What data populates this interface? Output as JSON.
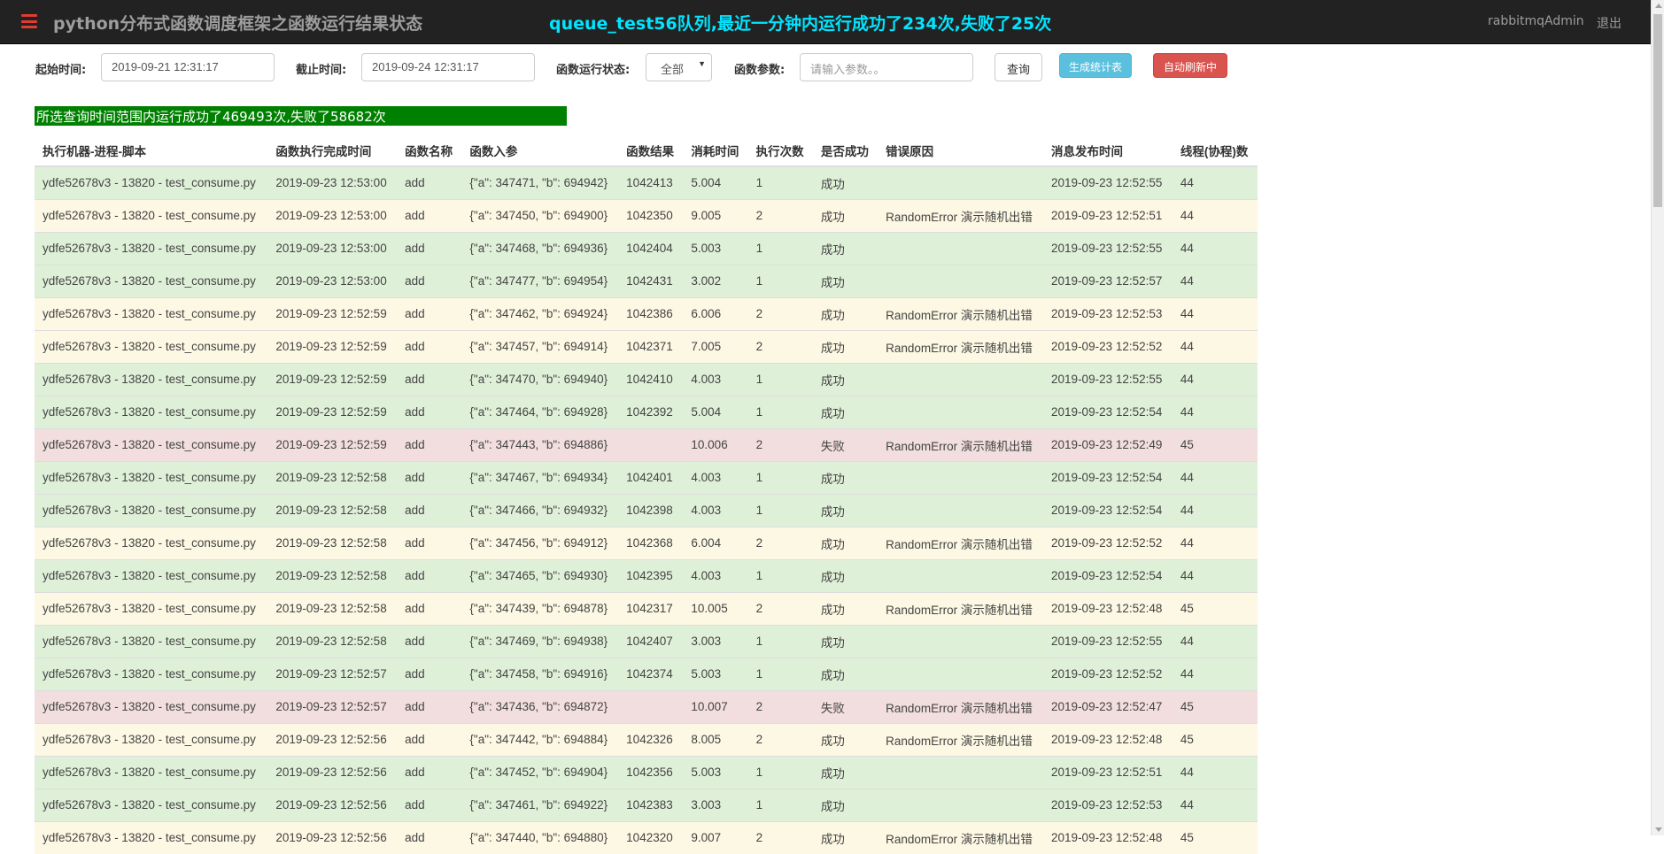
{
  "nav": {
    "title": "python分布式函数调度框架之函数运行结果状态",
    "summary": "queue_test56队列,最近一分钟内运行成功了234次,失败了25次",
    "user": "rabbitmqAdmin",
    "logout": "退出"
  },
  "filters": {
    "start_label": "起始时间:",
    "start_value": "2019-09-21 12:31:17",
    "end_label": "截止时间:",
    "end_value": "2019-09-24 12:31:17",
    "status_label": "函数运行状态:",
    "status_value": "全部",
    "params_label": "函数参数:",
    "params_placeholder": "请输入参数。。",
    "query_button": "查询",
    "stats_button": "生成统计表",
    "refresh_button": "自动刷新中"
  },
  "result_summary": "所选查询时间范围内运行成功了469493次,失败了58682次",
  "colors": {
    "success_row": "#dff0d8",
    "warning_row": "#fcf8e3",
    "danger_row": "#f2dede",
    "accent": "#00e5ff",
    "summary_bar": "#008000"
  },
  "table": {
    "headers": [
      "执行机器-进程-脚本",
      "函数执行完成时间",
      "函数名称",
      "函数入参",
      "函数结果",
      "消耗时间",
      "执行次数",
      "是否成功",
      "错误原因",
      "消息发布时间",
      "线程(协程)数"
    ],
    "rows": [
      {
        "status": "success",
        "cells": [
          "ydfe52678v3 - 13820 - test_consume.py",
          "2019-09-23 12:53:00",
          "add",
          "{\"a\": 347471, \"b\": 694942}",
          "1042413",
          "5.004",
          "1",
          "成功",
          "",
          "2019-09-23 12:52:55",
          "44"
        ]
      },
      {
        "status": "warning",
        "cells": [
          "ydfe52678v3 - 13820 - test_consume.py",
          "2019-09-23 12:53:00",
          "add",
          "{\"a\": 347450, \"b\": 694900}",
          "1042350",
          "9.005",
          "2",
          "成功",
          "RandomError 演示随机出错",
          "2019-09-23 12:52:51",
          "44"
        ]
      },
      {
        "status": "success",
        "cells": [
          "ydfe52678v3 - 13820 - test_consume.py",
          "2019-09-23 12:53:00",
          "add",
          "{\"a\": 347468, \"b\": 694936}",
          "1042404",
          "5.003",
          "1",
          "成功",
          "",
          "2019-09-23 12:52:55",
          "44"
        ]
      },
      {
        "status": "success",
        "cells": [
          "ydfe52678v3 - 13820 - test_consume.py",
          "2019-09-23 12:53:00",
          "add",
          "{\"a\": 347477, \"b\": 694954}",
          "1042431",
          "3.002",
          "1",
          "成功",
          "",
          "2019-09-23 12:52:57",
          "44"
        ]
      },
      {
        "status": "warning",
        "cells": [
          "ydfe52678v3 - 13820 - test_consume.py",
          "2019-09-23 12:52:59",
          "add",
          "{\"a\": 347462, \"b\": 694924}",
          "1042386",
          "6.006",
          "2",
          "成功",
          "RandomError 演示随机出错",
          "2019-09-23 12:52:53",
          "44"
        ]
      },
      {
        "status": "warning",
        "cells": [
          "ydfe52678v3 - 13820 - test_consume.py",
          "2019-09-23 12:52:59",
          "add",
          "{\"a\": 347457, \"b\": 694914}",
          "1042371",
          "7.005",
          "2",
          "成功",
          "RandomError 演示随机出错",
          "2019-09-23 12:52:52",
          "44"
        ]
      },
      {
        "status": "success",
        "cells": [
          "ydfe52678v3 - 13820 - test_consume.py",
          "2019-09-23 12:52:59",
          "add",
          "{\"a\": 347470, \"b\": 694940}",
          "1042410",
          "4.003",
          "1",
          "成功",
          "",
          "2019-09-23 12:52:55",
          "44"
        ]
      },
      {
        "status": "success",
        "cells": [
          "ydfe52678v3 - 13820 - test_consume.py",
          "2019-09-23 12:52:59",
          "add",
          "{\"a\": 347464, \"b\": 694928}",
          "1042392",
          "5.004",
          "1",
          "成功",
          "",
          "2019-09-23 12:52:54",
          "44"
        ]
      },
      {
        "status": "danger",
        "cells": [
          "ydfe52678v3 - 13820 - test_consume.py",
          "2019-09-23 12:52:59",
          "add",
          "{\"a\": 347443, \"b\": 694886}",
          "",
          "10.006",
          "2",
          "失败",
          "RandomError 演示随机出错",
          "2019-09-23 12:52:49",
          "45"
        ]
      },
      {
        "status": "success",
        "cells": [
          "ydfe52678v3 - 13820 - test_consume.py",
          "2019-09-23 12:52:58",
          "add",
          "{\"a\": 347467, \"b\": 694934}",
          "1042401",
          "4.003",
          "1",
          "成功",
          "",
          "2019-09-23 12:52:54",
          "44"
        ]
      },
      {
        "status": "success",
        "cells": [
          "ydfe52678v3 - 13820 - test_consume.py",
          "2019-09-23 12:52:58",
          "add",
          "{\"a\": 347466, \"b\": 694932}",
          "1042398",
          "4.003",
          "1",
          "成功",
          "",
          "2019-09-23 12:52:54",
          "44"
        ]
      },
      {
        "status": "warning",
        "cells": [
          "ydfe52678v3 - 13820 - test_consume.py",
          "2019-09-23 12:52:58",
          "add",
          "{\"a\": 347456, \"b\": 694912}",
          "1042368",
          "6.004",
          "2",
          "成功",
          "RandomError 演示随机出错",
          "2019-09-23 12:52:52",
          "44"
        ]
      },
      {
        "status": "success",
        "cells": [
          "ydfe52678v3 - 13820 - test_consume.py",
          "2019-09-23 12:52:58",
          "add",
          "{\"a\": 347465, \"b\": 694930}",
          "1042395",
          "4.003",
          "1",
          "成功",
          "",
          "2019-09-23 12:52:54",
          "44"
        ]
      },
      {
        "status": "warning",
        "cells": [
          "ydfe52678v3 - 13820 - test_consume.py",
          "2019-09-23 12:52:58",
          "add",
          "{\"a\": 347439, \"b\": 694878}",
          "1042317",
          "10.005",
          "2",
          "成功",
          "RandomError 演示随机出错",
          "2019-09-23 12:52:48",
          "45"
        ]
      },
      {
        "status": "success",
        "cells": [
          "ydfe52678v3 - 13820 - test_consume.py",
          "2019-09-23 12:52:58",
          "add",
          "{\"a\": 347469, \"b\": 694938}",
          "1042407",
          "3.003",
          "1",
          "成功",
          "",
          "2019-09-23 12:52:55",
          "44"
        ]
      },
      {
        "status": "success",
        "cells": [
          "ydfe52678v3 - 13820 - test_consume.py",
          "2019-09-23 12:52:57",
          "add",
          "{\"a\": 347458, \"b\": 694916}",
          "1042374",
          "5.003",
          "1",
          "成功",
          "",
          "2019-09-23 12:52:52",
          "44"
        ]
      },
      {
        "status": "danger",
        "cells": [
          "ydfe52678v3 - 13820 - test_consume.py",
          "2019-09-23 12:52:57",
          "add",
          "{\"a\": 347436, \"b\": 694872}",
          "",
          "10.007",
          "2",
          "失败",
          "RandomError 演示随机出错",
          "2019-09-23 12:52:47",
          "45"
        ]
      },
      {
        "status": "warning",
        "cells": [
          "ydfe52678v3 - 13820 - test_consume.py",
          "2019-09-23 12:52:56",
          "add",
          "{\"a\": 347442, \"b\": 694884}",
          "1042326",
          "8.005",
          "2",
          "成功",
          "RandomError 演示随机出错",
          "2019-09-23 12:52:48",
          "45"
        ]
      },
      {
        "status": "success",
        "cells": [
          "ydfe52678v3 - 13820 - test_consume.py",
          "2019-09-23 12:52:56",
          "add",
          "{\"a\": 347452, \"b\": 694904}",
          "1042356",
          "5.003",
          "1",
          "成功",
          "",
          "2019-09-23 12:52:51",
          "44"
        ]
      },
      {
        "status": "success",
        "cells": [
          "ydfe52678v3 - 13820 - test_consume.py",
          "2019-09-23 12:52:56",
          "add",
          "{\"a\": 347461, \"b\": 694922}",
          "1042383",
          "3.003",
          "1",
          "成功",
          "",
          "2019-09-23 12:52:53",
          "44"
        ]
      },
      {
        "status": "warning",
        "cells": [
          "ydfe52678v3 - 13820 - test_consume.py",
          "2019-09-23 12:52:56",
          "add",
          "{\"a\": 347440, \"b\": 694880}",
          "1042320",
          "9.007",
          "2",
          "成功",
          "RandomError 演示随机出错",
          "2019-09-23 12:52:48",
          "45"
        ]
      }
    ]
  }
}
